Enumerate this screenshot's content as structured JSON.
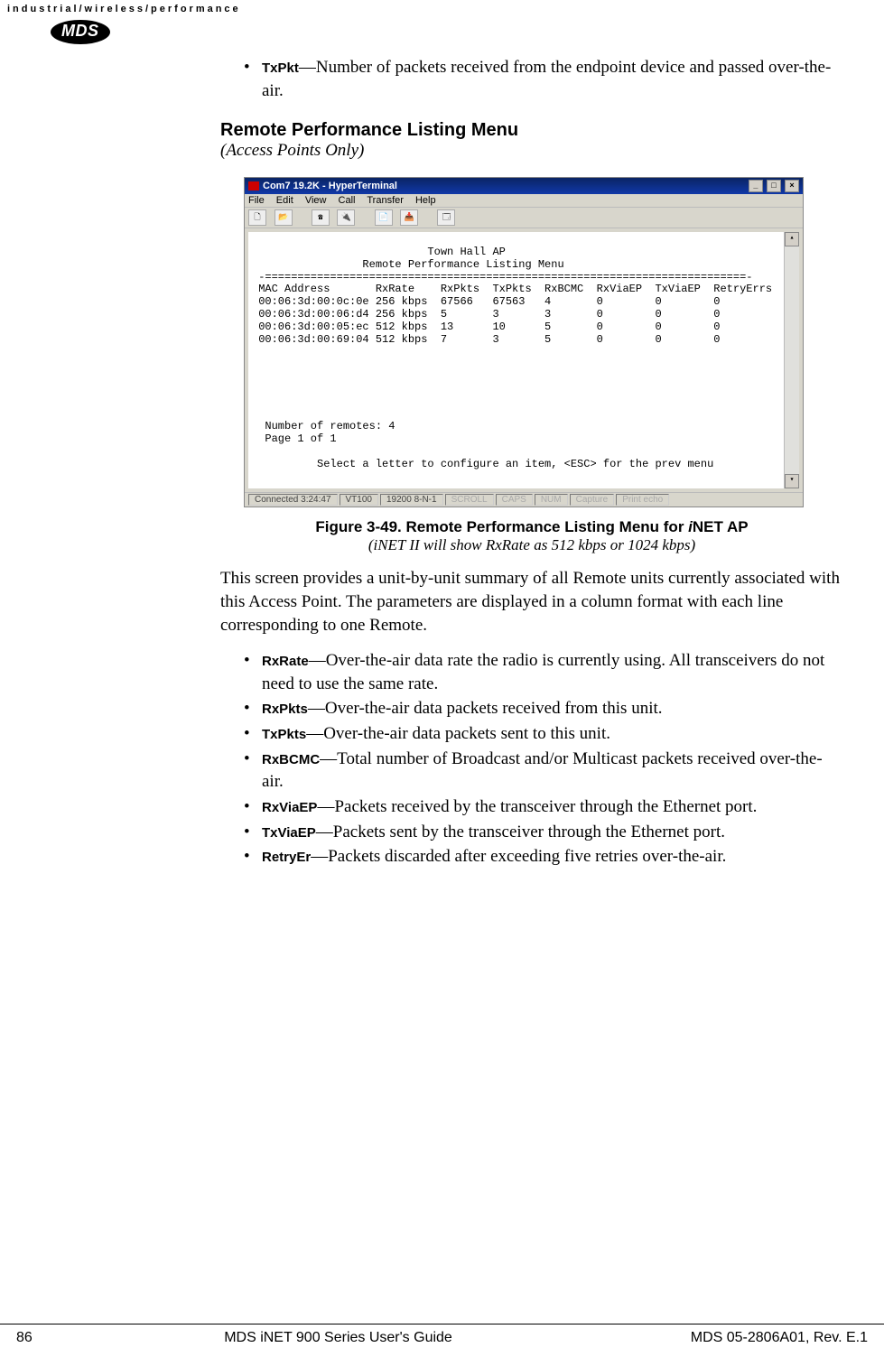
{
  "header": {
    "tagline": "industrial/wireless/performance",
    "logo_text": "MDS"
  },
  "intro_bullet": {
    "term": "TxPkt",
    "text": "—Number of packets received from the endpoint device and passed over-the-air."
  },
  "section": {
    "heading": "Remote Performance Listing Menu",
    "subtitle": "(Access Points Only)"
  },
  "hyperterminal": {
    "title": "Com7 19.2K - HyperTerminal",
    "menus": [
      "File",
      "Edit",
      "View",
      "Call",
      "Transfer",
      "Help"
    ],
    "terminal_title": "Town Hall AP",
    "terminal_subtitle": "Remote Performance Listing Menu",
    "columns": [
      "MAC Address",
      "RxRate",
      "RxPkts",
      "TxPkts",
      "RxBCMC",
      "RxViaEP",
      "TxViaEP",
      "RetryErrs"
    ],
    "rows": [
      {
        "mac": "00:06:3d:00:0c:0e",
        "rate": "256 kbps",
        "rx": "67566",
        "tx": "67563",
        "bcmc": "4",
        "rxep": "0",
        "txep": "0",
        "retry": "0"
      },
      {
        "mac": "00:06:3d:00:06:d4",
        "rate": "256 kbps",
        "rx": "5",
        "tx": "3",
        "bcmc": "3",
        "rxep": "0",
        "txep": "0",
        "retry": "0"
      },
      {
        "mac": "00:06:3d:00:05:ec",
        "rate": "512 kbps",
        "rx": "13",
        "tx": "10",
        "bcmc": "5",
        "rxep": "0",
        "txep": "0",
        "retry": "0"
      },
      {
        "mac": "00:06:3d:00:69:04",
        "rate": "512 kbps",
        "rx": "7",
        "tx": "3",
        "bcmc": "5",
        "rxep": "0",
        "txep": "0",
        "retry": "0"
      }
    ],
    "footer_line1": "Number of remotes: 4",
    "footer_line2": "Page 1 of 1",
    "prompt": "Select a letter to configure an item, <ESC> for the prev menu",
    "status": {
      "connected": "Connected 3:24:47",
      "emulation": "VT100",
      "settings": "19200 8-N-1",
      "scroll": "SCROLL",
      "caps": "CAPS",
      "num": "NUM",
      "capture": "Capture",
      "echo": "Print echo"
    }
  },
  "caption": {
    "main_prefix": "Figure 3-49. Remote Performance Listing Menu for ",
    "main_italic": "i",
    "main_suffix": "NET AP",
    "sub": "(iNET II will show RxRate as 512 kbps or 1024 kbps)"
  },
  "body_para": "This screen provides a unit-by-unit summary of all Remote units currently associated with this Access Point. The parameters are displayed in a column format with each line corresponding to one Remote.",
  "param_list": [
    {
      "term": "RxRate",
      "text": "—Over-the-air data rate the radio is currently using. All transceivers do not need to use the same rate."
    },
    {
      "term": "RxPkts",
      "text": "—Over-the-air data packets received from this unit."
    },
    {
      "term": "TxPkts",
      "text": "—Over-the-air data packets sent to this unit."
    },
    {
      "term": "RxBCMC",
      "text": "—Total number of Broadcast and/or Multicast packets received over-the-air."
    },
    {
      "term": "RxViaEP",
      "text": "—Packets received by the transceiver through the Ethernet port."
    },
    {
      "term": "TxViaEP",
      "text": "—Packets sent by the transceiver through the Ethernet port."
    },
    {
      "term": "RetryEr",
      "text": "—Packets discarded after exceeding five retries over-the-air."
    }
  ],
  "footer": {
    "page": "86",
    "center": "MDS iNET 900 Series User's Guide",
    "rev": "MDS 05-2806A01, Rev. E.1"
  }
}
